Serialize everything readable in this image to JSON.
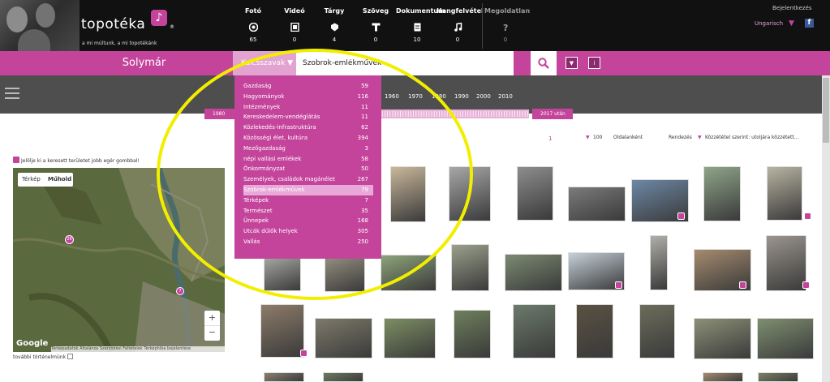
{
  "brand": {
    "name": "topotéka",
    "tagline": "a mi múltunk, a mi topotékánk",
    "reg": "®"
  },
  "media_types": [
    {
      "label": "Fotó",
      "count": "65",
      "icon": "photo-icon"
    },
    {
      "label": "Videó",
      "count": "0",
      "icon": "video-icon"
    },
    {
      "label": "Tárgy",
      "count": "4",
      "icon": "object-icon"
    },
    {
      "label": "Szöveg",
      "count": "0",
      "icon": "text-icon"
    },
    {
      "label": "Dokumentum",
      "count": "10",
      "icon": "document-icon"
    },
    {
      "label": "Hangfelvétel",
      "count": "0",
      "icon": "audio-icon"
    },
    {
      "label": "Megoldatlan",
      "count": "0",
      "icon": "question-icon"
    }
  ],
  "header": {
    "login": "Bejelentkezés",
    "language": "Ungarisch",
    "social": "f"
  },
  "search": {
    "place": "Solymár",
    "filter_label": "Kulcsszavak ▼",
    "query": "Szobrok-emlékművek"
  },
  "timeline": {
    "years": [
      "1960",
      "1970",
      "1980",
      "1990",
      "2000",
      "2010"
    ],
    "left_label": "1980 előtt",
    "right_label": "2017 után"
  },
  "results": {
    "page": "1",
    "per_page": "100",
    "per_page_label": "Oldalanként",
    "sort_label": "Rendezés",
    "sort_value": "Közzététel szerint: utoljára közzétett..."
  },
  "map": {
    "hint": "Jelölje ki a keresett területet jobb egér gombbal!",
    "type_map": "Térkép",
    "type_satellite": "Műhold",
    "zoom_in": "+",
    "zoom_out": "−",
    "google": "Google",
    "footer": "Térképadatok  Általános Szerződési Feltételek  Térképhiba bejelentése",
    "more": "további történelmünk",
    "cluster_1": "26",
    "cluster_2": "7"
  },
  "keywords": [
    {
      "label": "Gazdaság",
      "count": "59"
    },
    {
      "label": "Hagyományok",
      "count": "116"
    },
    {
      "label": "Intézmények",
      "count": "11"
    },
    {
      "label": "Kereskedelem-vendéglátás",
      "count": "11"
    },
    {
      "label": "Közlekedés-infrastruktúra",
      "count": "62"
    },
    {
      "label": "Közösségi élet, kultúra",
      "count": "394"
    },
    {
      "label": "Mezőgazdaság",
      "count": "3"
    },
    {
      "label": "népi vallási emlékek",
      "count": "58"
    },
    {
      "label": "Önkormányzat",
      "count": "50"
    },
    {
      "label": "Személyek, családok magánélet",
      "count": "267"
    },
    {
      "label": "Szobrok-emlékművek",
      "count": "79",
      "selected": true
    },
    {
      "label": "Térképek",
      "count": "7"
    },
    {
      "label": "Természet",
      "count": "35"
    },
    {
      "label": "Ünnepek",
      "count": "168"
    },
    {
      "label": "Utcák dűlők helyek",
      "count": "305"
    },
    {
      "label": "Vallás",
      "count": "250"
    }
  ],
  "colors": {
    "accent": "#c4449c",
    "highlight": "#f2ee00",
    "dark": "#111111",
    "gray": "#4e4e4e"
  }
}
